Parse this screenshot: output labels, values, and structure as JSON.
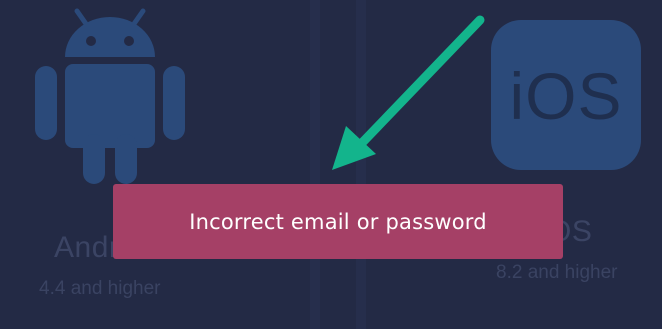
{
  "platforms": [
    {
      "name": "Android",
      "visible_name": "Andr",
      "requirement": "4.4 and higher",
      "icon": "android-icon"
    },
    {
      "name": "iOS",
      "visible_name": "OS",
      "requirement": "8.2 and higher",
      "icon": "ios-icon",
      "icon_text": "iOS"
    }
  ],
  "toast": {
    "message": "Incorrect email or password"
  },
  "annotation": {
    "icon": "pointer-arrow"
  },
  "colors": {
    "background": "#232a45",
    "icon_fill": "#2b4a7a",
    "toast_bg": "#a54066",
    "toast_text": "#ffffff",
    "arrow": "#13b48c"
  }
}
